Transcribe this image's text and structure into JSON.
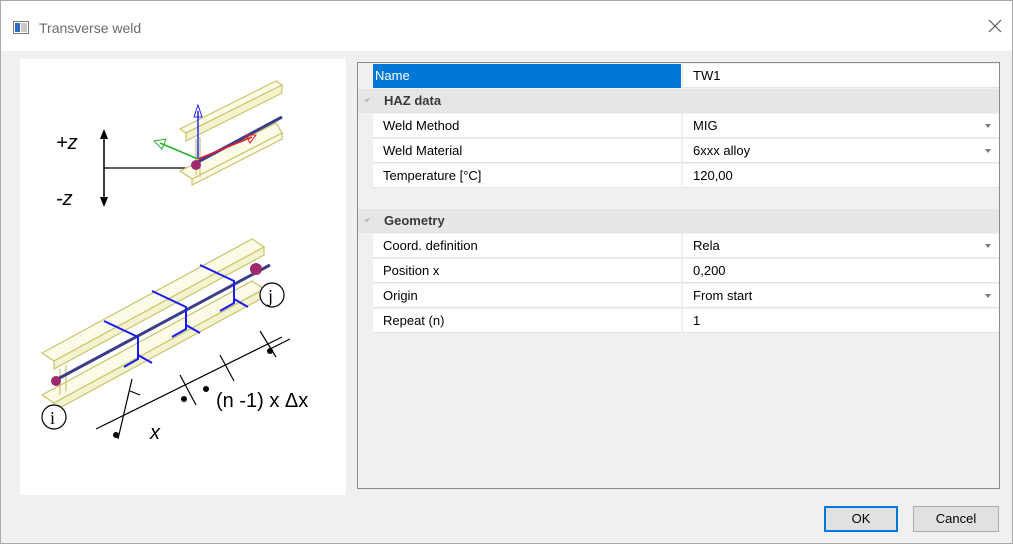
{
  "window": {
    "title": "Transverse weld"
  },
  "illustration": {
    "z_plus": "+z",
    "z_minus": "-z",
    "node_start": "i",
    "node_end": "j",
    "dim_x": "x",
    "dim_repeat": "(n -1) x Δx"
  },
  "properties": {
    "name_row": {
      "label": "Name",
      "value": "TW1"
    },
    "categories": [
      {
        "title": "HAZ data",
        "rows": [
          {
            "label": "Weld Method",
            "value": "MIG",
            "dropdown": true
          },
          {
            "label": "Weld Material",
            "value": "6xxx alloy",
            "dropdown": true
          },
          {
            "label": "Temperature [°C]",
            "value": "120,00",
            "dropdown": false
          }
        ]
      },
      {
        "title": "Geometry",
        "rows": [
          {
            "label": "Coord. definition",
            "value": "Rela",
            "dropdown": true
          },
          {
            "label": "Position x",
            "value": "0,200",
            "dropdown": false
          },
          {
            "label": "Origin",
            "value": "From start",
            "dropdown": true
          },
          {
            "label": "Repeat (n)",
            "value": "1",
            "dropdown": false
          }
        ]
      }
    ]
  },
  "buttons": {
    "ok": "OK",
    "cancel": "Cancel"
  },
  "colors": {
    "selection": "#0078d7",
    "weld": "#1a1aff",
    "beam": "#d8d58a",
    "node": "#a0286e"
  }
}
